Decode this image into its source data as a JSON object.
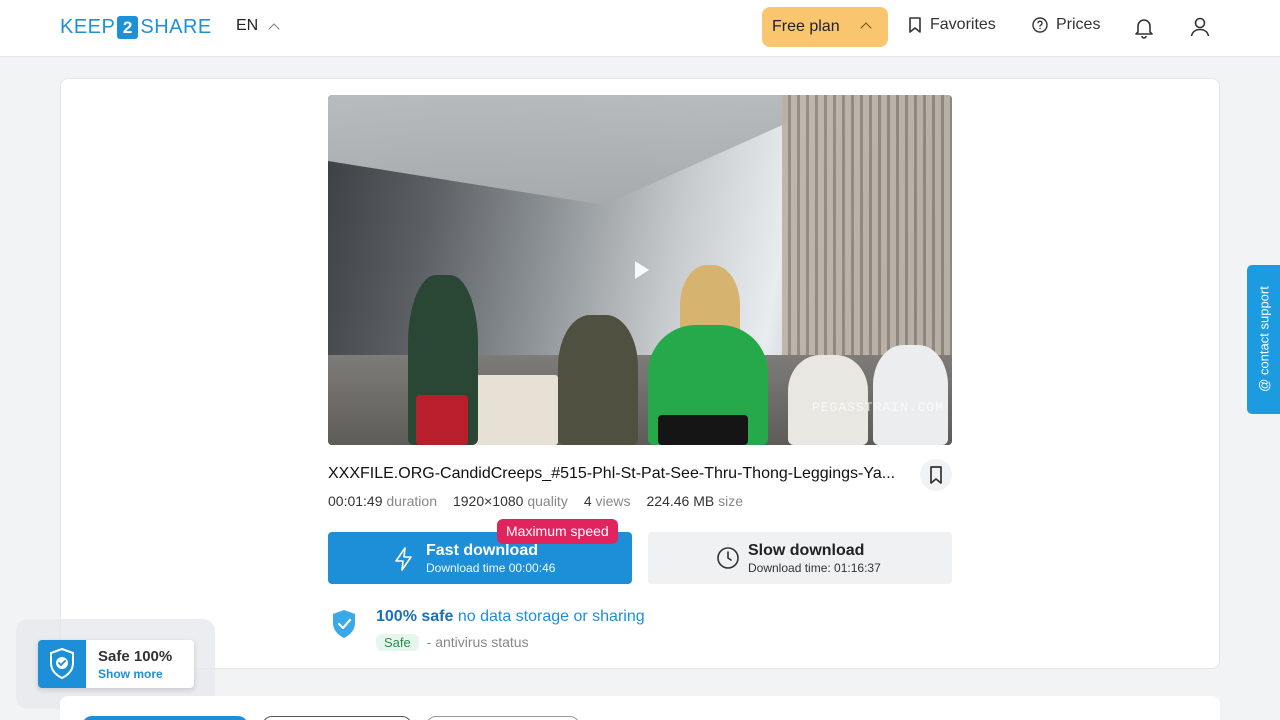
{
  "header": {
    "logo_left": "KEEP",
    "logo_mid": "2",
    "logo_right": "SHARE",
    "language": "EN",
    "plan_label": "Free plan",
    "favorites_label": "Favorites",
    "prices_label": "Prices"
  },
  "file": {
    "title": "XXXFILE.ORG-CandidCreeps_#515-Phl-St-Pat-See-Thru-Thong-Leggings-Ya...",
    "duration_value": "00:01:49",
    "duration_label": "duration",
    "quality_value": "1920×1080",
    "quality_label": "quality",
    "views_value": "4",
    "views_label": "views",
    "size_value": "224.46 MB",
    "size_label": "size",
    "video_watermark": "PEGASSTRAIN.COM"
  },
  "download": {
    "fast_label": "Fast download",
    "fast_time": "Download time 00:00:46",
    "badge": "Maximum speed",
    "slow_label": "Slow download",
    "slow_time": "Download time: 01:16:37"
  },
  "safety": {
    "headline_strong": "100% safe",
    "headline_rest": "no data storage or sharing",
    "pill": "Safe",
    "status_text": "- antivirus status"
  },
  "widget": {
    "title": "Safe 100%",
    "link": "Show more"
  },
  "support": {
    "label": "@ contact support"
  },
  "colors": {
    "accent": "#1d8fd8",
    "plan": "#f9c66f",
    "badge": "#e0245e"
  }
}
